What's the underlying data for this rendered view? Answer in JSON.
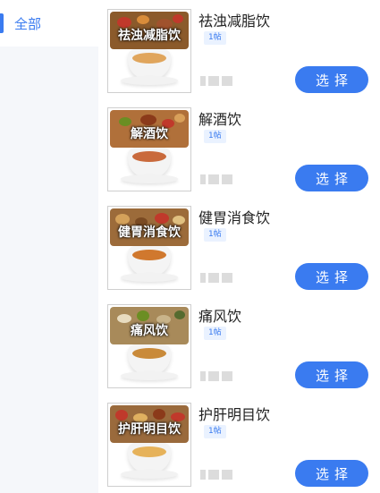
{
  "sidebar": {
    "categories": [
      {
        "label": "全部",
        "active": true
      }
    ]
  },
  "accent_color": "#3a7bf0",
  "products": [
    {
      "name": "祛浊减脂饮",
      "image_caption": "祛浊减脂饮",
      "tag": "1帖",
      "select_label": "选择",
      "tea_color": "#e0a55c"
    },
    {
      "name": "解酒饮",
      "image_caption": "解酒饮",
      "tag": "1帖",
      "select_label": "选择",
      "tea_color": "#c96a3c"
    },
    {
      "name": "健胃消食饮",
      "image_caption": "健胃消食饮",
      "tag": "1帖",
      "select_label": "选择",
      "tea_color": "#d0782e"
    },
    {
      "name": "痛风饮",
      "image_caption": "痛风饮",
      "tag": "1帖",
      "select_label": "选择",
      "tea_color": "#c98a3a"
    },
    {
      "name": "护肝明目饮",
      "image_caption": "护肝明目饮",
      "tag": "1帖",
      "select_label": "选择",
      "tea_color": "#e6b25a"
    }
  ]
}
